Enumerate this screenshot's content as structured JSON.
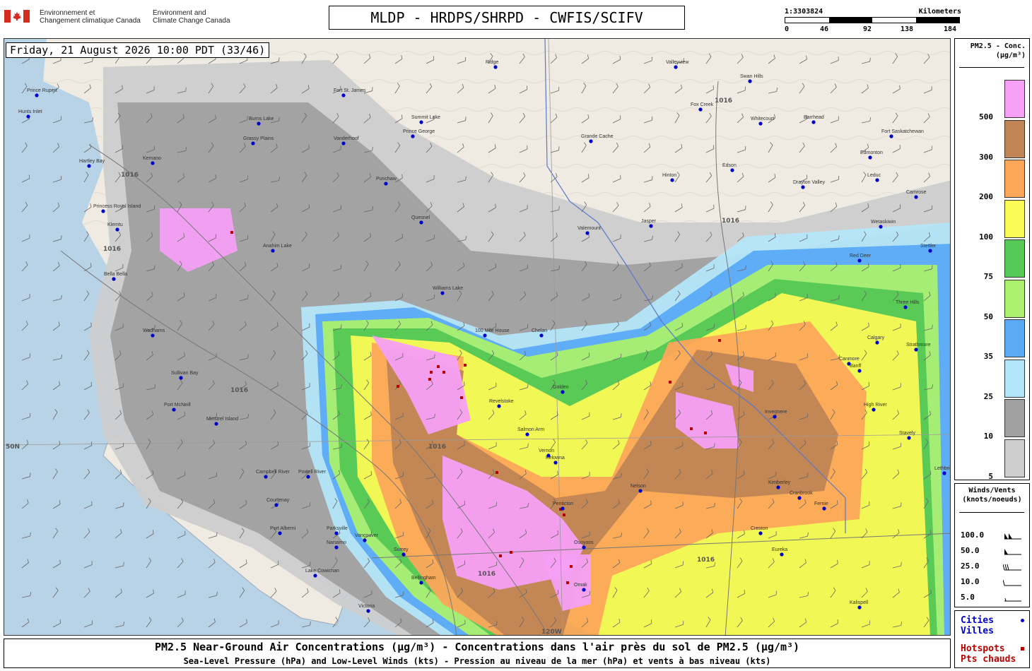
{
  "header": {
    "dept_fr_line1": "Environnement et",
    "dept_fr_line2": "Changement climatique Canada",
    "dept_en_line1": "Environment and",
    "dept_en_line2": "Climate Change Canada",
    "title": "MLDP - HRDPS/SHRPD - CWFIS/SCIFV"
  },
  "scale": {
    "ratio": "1:3303824",
    "unit": "Kilometers",
    "ticks": [
      "0",
      "46",
      "92",
      "138",
      "184"
    ]
  },
  "map": {
    "datetime": "Friday, 21 August 2026 10:00 PDT (33/46)",
    "lat_label": "50N",
    "lon_label": "120W",
    "isobar_value": "1016",
    "cities": [
      "Prince Rupert",
      "Hunts Inlet",
      "Burns Lake",
      "Fort St. James",
      "Grassy Plains",
      "Summit Lake",
      "Vanderhoof",
      "Prince George",
      "Grande Cache",
      "Fox Creek",
      "Whitecourt",
      "Barrhead",
      "Swan Hills",
      "Valleyview",
      "Ridge",
      "Fort Saskatchewan",
      "Edmonton",
      "Edson",
      "Hinton",
      "Drayton Valley",
      "Leduc",
      "Camrose",
      "Wetaskiwin",
      "Kemano",
      "Hartley Bay",
      "Princess Royal Island",
      "Klemtu",
      "Punchaw",
      "Quesnel",
      "Valemount",
      "Jasper",
      "Bella Bella",
      "Anahim Lake",
      "Williams Lake",
      "100 Mile House",
      "Red Deer",
      "Stettler",
      "Three Hills",
      "Wadhams",
      "Sullivan Bay",
      "Port McNeill",
      "Minstrel Island",
      "Campbell River",
      "Powell River",
      "Courtenay",
      "Port Alberni",
      "Parksville",
      "Nanaimo",
      "Vancouver",
      "Surrey",
      "Lake Cowichan",
      "Victoria",
      "Bellingham",
      "Penticton",
      "Osoyoos",
      "Omak",
      "Kelowna",
      "Invermere",
      "Banff",
      "Canmore",
      "Cranbrook",
      "Fernie",
      "Kimberley",
      "Eureka",
      "Creston",
      "Kalispell",
      "High River",
      "Strathmore",
      "Calgary",
      "Stavely",
      "Lethbridge",
      "Chelan",
      "Golden",
      "Revelstoke",
      "Salmon Arm",
      "Vernon",
      "Nelson"
    ]
  },
  "legend": {
    "title_line1": "PM2.5 - Conc.",
    "title_line2": "(µg/m³)",
    "bins": [
      {
        "label": "500",
        "color": "#f5a0f5"
      },
      {
        "label": "300",
        "color": "#c08555"
      },
      {
        "label": "200",
        "color": "#fca75a"
      },
      {
        "label": "100",
        "color": "#fafa55"
      },
      {
        "label": "75",
        "color": "#55c855"
      },
      {
        "label": "50",
        "color": "#aaf06e"
      },
      {
        "label": "35",
        "color": "#5aaaf5"
      },
      {
        "label": "25",
        "color": "#b4e6fa"
      },
      {
        "label": "10",
        "color": "#a0a0a0"
      },
      {
        "label": "5",
        "color": "#cdcdcd"
      }
    ]
  },
  "winds": {
    "title_line1": "Winds/Vents",
    "title_line2": "(knots/noeuds)",
    "rows": [
      {
        "label": "100.0",
        "pennants": 2,
        "barbs": 0
      },
      {
        "label": "50.0",
        "pennants": 1,
        "barbs": 0
      },
      {
        "label": "25.0",
        "pennants": 0,
        "barbs": 3
      },
      {
        "label": "10.0",
        "pennants": 0,
        "barbs": 1
      },
      {
        "label": "5.0",
        "pennants": 0,
        "barbs": 0.5
      }
    ]
  },
  "markers": {
    "cities_line1": "Cities",
    "cities_line2": "Villes",
    "hotspots_line1": "Hotspots",
    "hotspots_line2": "Pts chauds",
    "cities_color": "#0000cc",
    "hotspots_color": "#bb0000"
  },
  "footer": {
    "title": "PM2.5 Near-Ground Air Concentrations (µg/m³) - Concentrations dans l'air près du sol de PM2.5 (µg/m³)",
    "subtitle": "Sea-Level Pressure (hPa) and Low-Level Winds (kts) - Pression au niveau de la mer (hPa) et vents à bas niveau (kts)"
  }
}
